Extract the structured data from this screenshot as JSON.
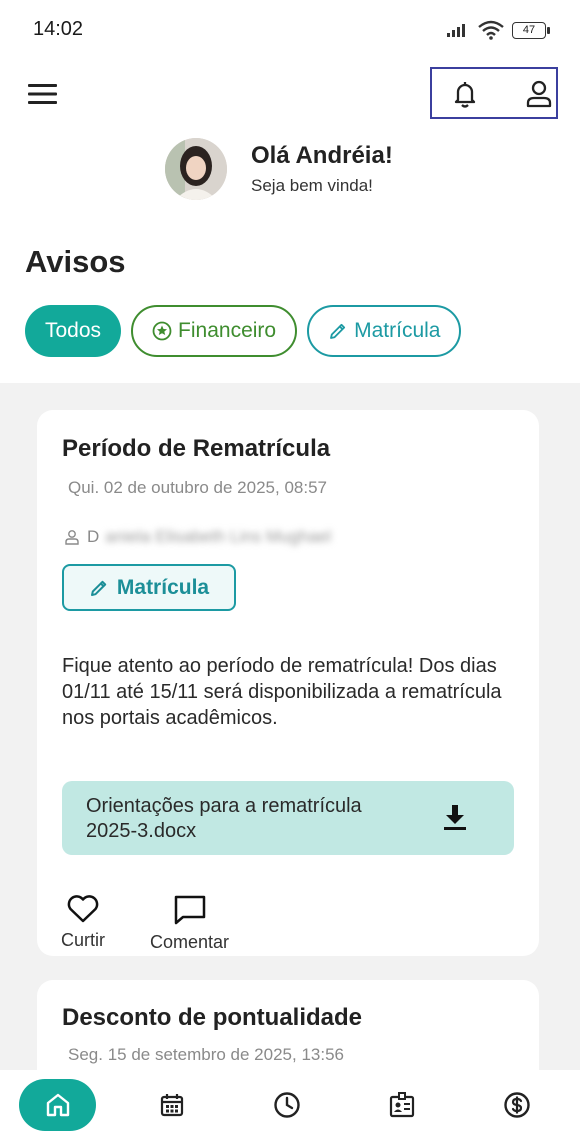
{
  "status": {
    "time": "14:02",
    "battery": "47"
  },
  "greeting": {
    "title": "Olá Andréia!",
    "subtitle": "Seja bem vinda!"
  },
  "section_title": "Avisos",
  "filters": [
    {
      "label": "Todos",
      "active": true
    },
    {
      "label": "Financeiro",
      "icon": "star-circle-icon"
    },
    {
      "label": "Matrícula",
      "icon": "pencil-icon"
    }
  ],
  "posts": [
    {
      "title": "Período de Rematrícula",
      "date": "Qui. 02 de outubro de 2025, 08:57",
      "author_initial": "D",
      "author_rest": "aniela Elisabeth Lins Mughael",
      "tag": "Matrícula",
      "body": "Fique atento ao período de rematrícula! Dos dias 01/11 até 15/11 será disponibilizada a rematrícula nos portais acadêmicos.",
      "attachment": "Orientações para a rematrícula 2025-3.docx",
      "like_label": "Curtir",
      "comment_label": "Comentar"
    },
    {
      "title": "Desconto de pontualidade",
      "date": "Seg. 15 de setembro de 2025, 13:56"
    }
  ],
  "colors": {
    "accent": "#12a99a",
    "financeiro": "#3f8d2f",
    "matricula": "#1c9aa3",
    "attachment_bg": "#c1e8e3"
  }
}
